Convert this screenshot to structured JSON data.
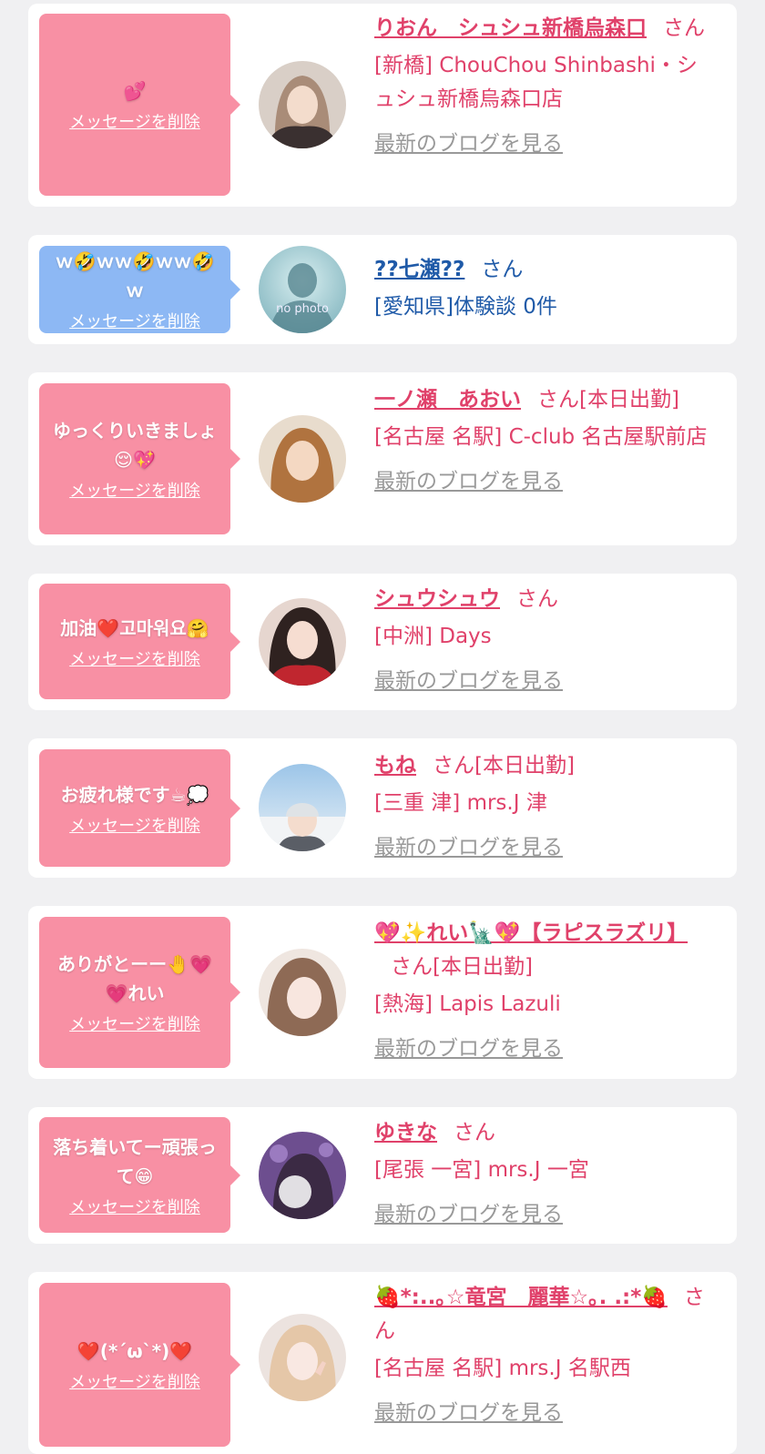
{
  "delete_label": "メッセージを削除",
  "blog_label": "最新のブログを見る",
  "cards": [
    {
      "message": "💕",
      "name": "りおん　シュシュ新橋烏森口",
      "honorific": "さん",
      "status": "",
      "shop": "[新橋] ChouChou Shinbashi・シュシュ新橋烏森口店"
    },
    {
      "message": "ｗ🤣ｗｗ🤣ｗｗ🤣ｗ",
      "name": "??七瀬??",
      "honorific": "さん",
      "status": "",
      "shop": "[愛知県]体験談 0件",
      "avatar_text": "no photo"
    },
    {
      "message": "ゆっくりいきましょ😌💖",
      "name": "一ノ瀬　あおい",
      "honorific": "さん",
      "status": "[本日出勤]",
      "shop": "[名古屋 名駅] C-club 名古屋駅前店"
    },
    {
      "message": "加油❤️고마워요🤗",
      "name": "シュウシュウ",
      "honorific": "さん",
      "status": "",
      "shop": "[中洲] Days"
    },
    {
      "message": "お疲れ様です☕💭",
      "name": "もね",
      "honorific": "さん",
      "status": "[本日出勤]",
      "shop": "[三重 津] mrs.J 津"
    },
    {
      "message": "ありがとーー🤚💗💗れい",
      "name": "💖✨れい🗽💖【ラピスラズリ】",
      "honorific": "さん",
      "status": "[本日出勤]",
      "shop": "[熱海] Lapis Lazuli"
    },
    {
      "message": "落ち着いてー頑張って😁",
      "name": "ゆきな",
      "honorific": "さん",
      "status": "",
      "shop": "[尾張 一宮] mrs.J 一宮"
    },
    {
      "message": "❤️(*´ω`*)❤️",
      "name": "🍓*:..｡☆竜宮　麗華☆｡. .:*🍓",
      "honorific": "さん",
      "status": "",
      "shop": "[名古屋 名駅] mrs.J 名駅西"
    }
  ],
  "colors": {
    "page_bg": "#f0f0f2",
    "bubble_pink": "#f890a4",
    "bubble_blue": "#8db8f4",
    "name_pink": "#e0416a",
    "name_blue": "#1f5aa8",
    "blog_gray": "#999999"
  }
}
